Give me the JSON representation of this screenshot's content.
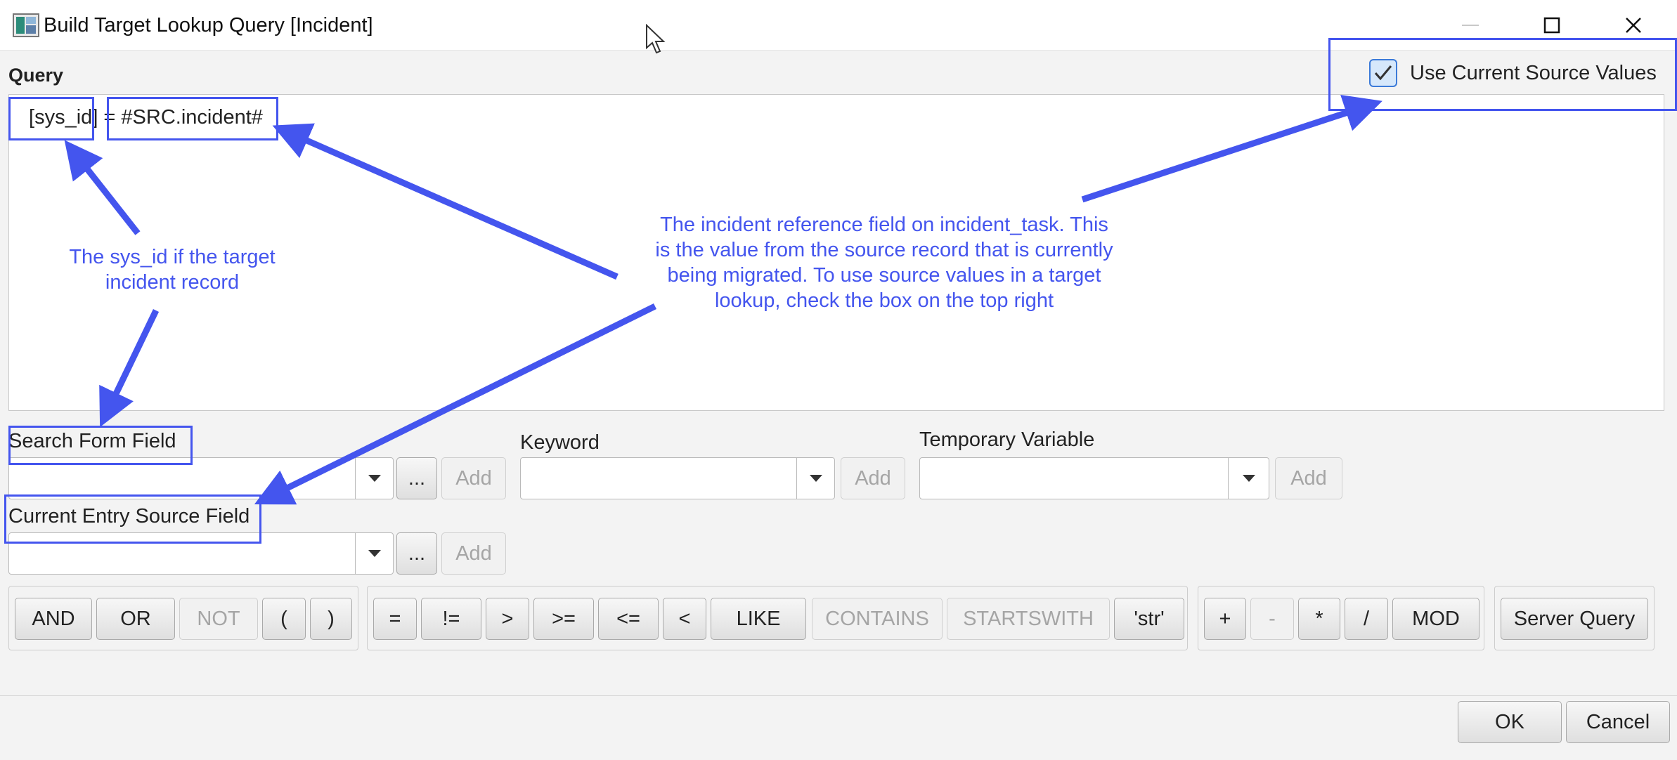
{
  "window": {
    "title": "Build Target Lookup Query [Incident]",
    "controls": [
      "minimize",
      "maximize",
      "close"
    ]
  },
  "query": {
    "label": "Query",
    "text": " [sys_id] = #SRC.incident#",
    "use_current_source_values": {
      "label": "Use Current Source Values",
      "checked": true
    }
  },
  "fields": {
    "search_form_field": {
      "label": "Search Form Field",
      "value": "",
      "browse_label": "...",
      "add_label": "Add"
    },
    "keyword": {
      "label": "Keyword",
      "value": "",
      "add_label": "Add"
    },
    "temporary_variable": {
      "label": "Temporary Variable",
      "value": "",
      "add_label": "Add"
    },
    "current_entry_source_field": {
      "label": "Current Entry Source Field",
      "value": "",
      "browse_label": "...",
      "add_label": "Add"
    }
  },
  "operators": {
    "logic": [
      "AND",
      "OR",
      "NOT",
      "(",
      ")"
    ],
    "comparison": [
      "=",
      "!=",
      ">",
      ">=",
      "<=",
      "<",
      "LIKE",
      "CONTAINS",
      "STARTSWITH",
      "'str'"
    ],
    "arithmetic": [
      "+",
      "-",
      "*",
      "/",
      "MOD"
    ],
    "server_query": "Server Query"
  },
  "dialog_buttons": {
    "ok": "OK",
    "cancel": "Cancel"
  },
  "annotations": {
    "sys_id_note": "The sys_id if the target\nincident record",
    "incident_note": "The incident reference field on incident_task. This\nis the value from the source record that is currently\nbeing migrated. To use source values in a target\nlookup, check the box on the top right",
    "color": "#4455ee"
  },
  "colors": {
    "accent": "#3b7ad8",
    "annotation": "#4455ee",
    "background": "#f3f3f3"
  },
  "icons": [
    "app-icon",
    "minimize-icon",
    "maximize-icon",
    "close-icon",
    "check-icon",
    "chevron-down-icon",
    "mouse-cursor-icon"
  ]
}
